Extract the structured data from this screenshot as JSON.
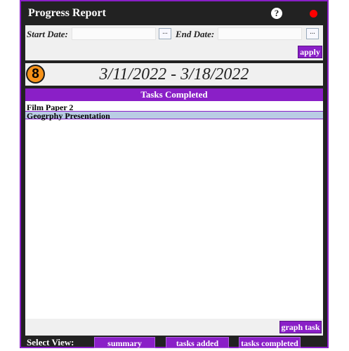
{
  "window": {
    "title": "Progress Report",
    "help_glyph": "?"
  },
  "filters": {
    "start_label": "Start Date:",
    "end_label": "End Date:",
    "start_value": "",
    "end_value": "",
    "picker_label": "...",
    "apply_label": "apply"
  },
  "period": {
    "badge": "8",
    "range": "3/11/2022 - 3/18/2022"
  },
  "tasks": {
    "header": "Tasks Completed",
    "items": [
      "Film Paper 2",
      "Geogrphy Presentation"
    ]
  },
  "graph": {
    "button_label": "graph task"
  },
  "views": {
    "label": "Select View:",
    "summary": "summary",
    "tasks_added": "tasks added",
    "tasks_completed": "tasks completed"
  },
  "colors": {
    "accent": "#8a1fc7",
    "frame": "#222222",
    "badge": "#f7931a",
    "close": "#ff0000",
    "row_highlight": "#b9cce4"
  }
}
